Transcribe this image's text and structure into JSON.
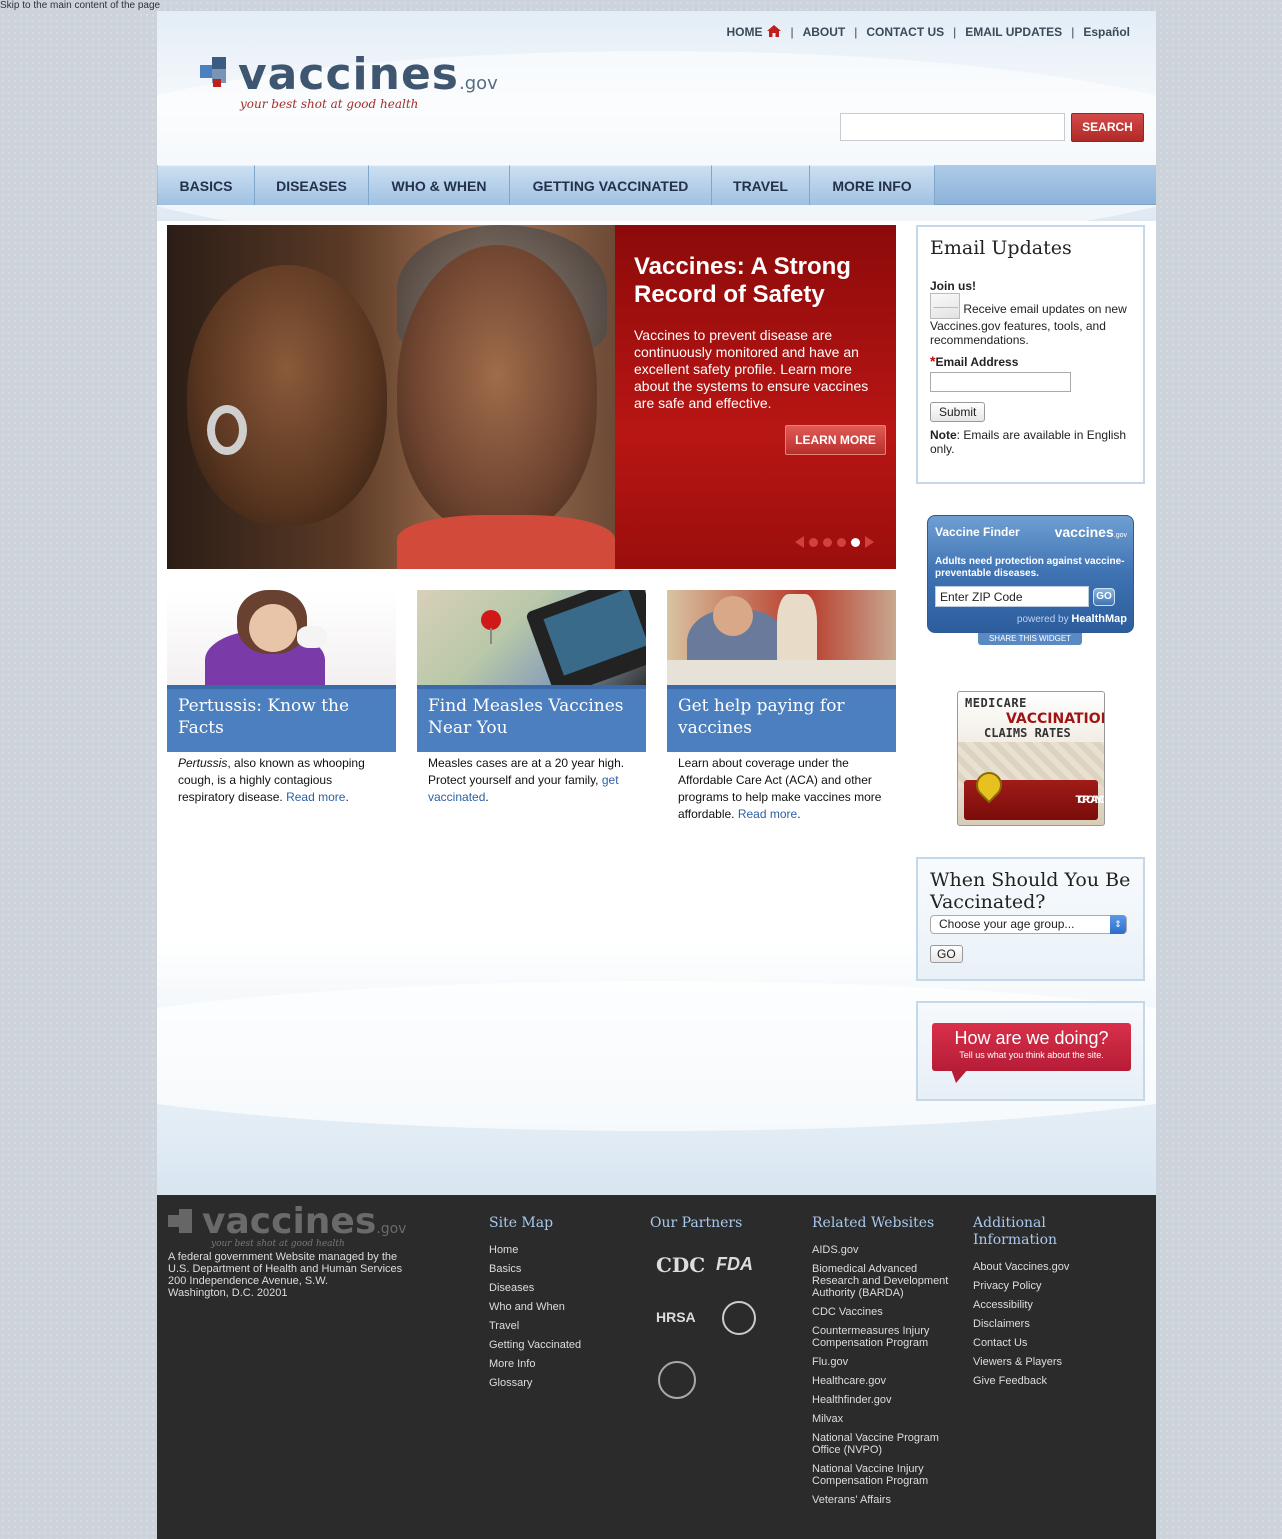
{
  "skip_link": "Skip to the main content of the page",
  "header": {
    "util_nav": [
      "HOME",
      "ABOUT",
      "CONTACT US",
      "EMAIL UPDATES",
      "Español"
    ],
    "logo_word": "vaccines",
    "logo_gov": ".gov",
    "tagline": "your best shot at good health",
    "search_value": "",
    "search_button": "SEARCH"
  },
  "nav": {
    "tabs": [
      "BASICS",
      "DISEASES",
      "WHO & WHEN",
      "GETTING VACCINATED",
      "TRAVEL",
      "MORE INFO"
    ]
  },
  "hero": {
    "title": "Vaccines: A Strong Record of Safety",
    "body": "Vaccines to prevent disease are continuously monitored and have an excellent safety profile. Learn more about the systems to ensure vaccines are safe and effective.",
    "button": "LEARN MORE",
    "slides": 4,
    "active_slide": 4
  },
  "cards": [
    {
      "title": "Pertussis: Know the Facts",
      "text_em": "Pertussis",
      "text": ", also known as whooping cough, is a highly contagious respiratory disease.",
      "link": "Read more",
      "end": "."
    },
    {
      "title": "Find Measles Vaccines Near You",
      "text": "Measles cases are at a 20 year high. Protect yourself and your family,",
      "link": "get vaccinated",
      "end": "."
    },
    {
      "title": "Get help paying for vaccines",
      "text": "Learn about coverage under the Affordable Care Act (ACA) and other programs to help make vaccines more affordable.",
      "link": "Read more",
      "end": "."
    }
  ],
  "email_updates": {
    "heading": "Email Updates",
    "join": "Join us!",
    "desc": "Receive email updates on new Vaccines.gov features, tools, and recommendations.",
    "field_label": "Email Address",
    "email_value": "",
    "submit": "Submit",
    "note_label": "Note",
    "note": ": Emails are available in English only."
  },
  "vaccine_finder": {
    "title": "Vaccine Finder",
    "logo": "vaccines",
    "logo_gov": ".gov",
    "sub": "Adults need protection against vaccine-preventable diseases.",
    "zip_value": "Enter ZIP Code",
    "go": "GO",
    "powered_by": "powered by",
    "powered_name": "HealthMap",
    "share": "SHARE THIS WIDGET"
  },
  "medicare": {
    "line1": "MEDICARE",
    "line2": "VACCINATION",
    "line3": "CLAIMS RATES",
    "button_l1": "TRACK YOUR",
    "button_l2": "COMMUNITY"
  },
  "when_box": {
    "heading": "When Should You Be Vaccinated?",
    "select_value": "Choose your age group...",
    "go": "GO"
  },
  "feedback": {
    "question": "How are we doing?",
    "sub": "Tell us what you think about the site."
  },
  "footer": {
    "logo_word": "vaccines",
    "logo_gov": ".gov",
    "tagline": "your best shot at good health",
    "address": "A federal government Website managed by the\nU.S. Department of Health and Human Services\n200 Independence Avenue, S.W.\nWashington, D.C. 20201",
    "sitemap_heading": "Site Map",
    "sitemap": [
      "Home",
      "Basics",
      "Diseases",
      "Who and When",
      "Travel",
      "Getting Vaccinated",
      "More Info",
      "Glossary"
    ],
    "partners_heading": "Our Partners",
    "partners": [
      "CDC",
      "FDA",
      "HRSA"
    ],
    "related_heading": "Related Websites",
    "related": [
      "AIDS.gov",
      "Biomedical Advanced Research and Development Authority (BARDA)",
      "CDC Vaccines",
      "Countermeasures Injury Compensation Program",
      "Flu.gov",
      "Healthcare.gov",
      "Healthfinder.gov",
      "Milvax",
      "National Vaccine Program Office (NVPO)",
      "National Vaccine Injury Compensation Program",
      "Veterans' Affairs"
    ],
    "additional_heading": "Additional Information",
    "additional": [
      "About Vaccines.gov",
      "Privacy Policy",
      "Accessibility",
      "Disclaimers",
      "Contact Us",
      "Viewers & Players",
      "Give Feedback"
    ]
  },
  "colors": {
    "accent_red": "#b02a28",
    "nav_blue": "#9fc1e2",
    "card_blue": "#4b7fbf",
    "footer_bg": "#2b2b2b"
  }
}
